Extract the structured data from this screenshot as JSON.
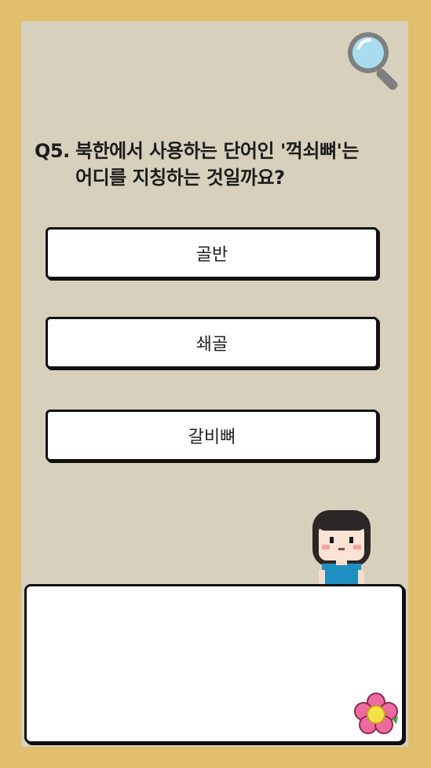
{
  "quiz": {
    "question_number": "Q5.",
    "question_line1": "북한에서 사용하는 단어인 '꺽쇠뼈'는",
    "question_line2": "어디를 지칭하는 것일까요?",
    "options": [
      {
        "label": "골반"
      },
      {
        "label": "쇄골"
      },
      {
        "label": "갈비뼈"
      }
    ]
  },
  "dialog": {
    "text": ""
  },
  "icons": {
    "search": "magnifier-icon",
    "character": "girl-character",
    "flower": "flower-icon"
  },
  "colors": {
    "border": "#e2bf6c",
    "panel": "#d7d0bc",
    "card": "#ffffff",
    "outline": "#111111"
  }
}
